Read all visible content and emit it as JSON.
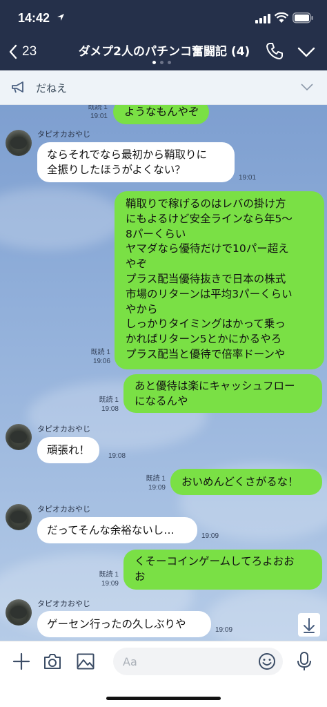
{
  "status_bar": {
    "time": "14:42"
  },
  "header": {
    "back_count": "23",
    "title": "ダメプ2人のパチンコ奮闘記 (4)"
  },
  "announcement": {
    "text": "だねえ"
  },
  "messages": [
    {
      "side": "me",
      "text": "ようなもんやぞ",
      "read": "既読 1",
      "time": "19:01"
    },
    {
      "side": "them",
      "sender": "タピオカおやじ",
      "lines": [
        "ならそれでなら最初から鞘取りに",
        "全振りしたほうがよくない？"
      ],
      "time": "19:01"
    },
    {
      "side": "me",
      "lines": [
        "鞘取りで稼げるのはレバの掛け方",
        "にもよるけど安全ラインなら年5〜",
        "8パーくらい",
        "ヤマダなら優待だけで10パー超え",
        "やぞ",
        "プラス配当優待抜きで日本の株式",
        "市場のリターンは平均3パーくらい",
        "やから",
        "しっかりタイミングはかって乗っ",
        "かればリターン5とかにかるやろ",
        "プラス配当と優待で倍率ドーンや"
      ],
      "read": "既読 1",
      "time": "19:06"
    },
    {
      "side": "me",
      "lines": [
        "あと優待は楽にキャッシュフロー",
        "になるんや"
      ],
      "read": "既読 1",
      "time": "19:08"
    },
    {
      "side": "them",
      "sender": "タピオカおやじ",
      "lines": [
        "頑張れ！"
      ],
      "time": "19:08"
    },
    {
      "side": "me",
      "lines": [
        "おいめんどくさがるな！"
      ],
      "read": "既読 1",
      "time": "19:09"
    },
    {
      "side": "them",
      "sender": "タピオカおやじ",
      "lines": [
        "だってそんな余裕ないし…"
      ],
      "time": "19:09"
    },
    {
      "side": "me",
      "lines": [
        "くそーコインゲームしてろよおお",
        "お"
      ],
      "read": "既読 1",
      "time": "19:09"
    },
    {
      "side": "them",
      "sender": "タピオカおやじ",
      "lines": [
        "ゲーセン行ったの久しぶりや"
      ],
      "time": "19:09"
    }
  ],
  "input": {
    "placeholder": "Aa"
  },
  "colors": {
    "header_bg": "#25304a",
    "my_bubble": "#7ae045",
    "their_bubble": "#ffffff"
  },
  "icons": [
    "location-arrow-icon",
    "signal-icon",
    "wifi-icon",
    "battery-icon",
    "back-chevron-icon",
    "phone-icon",
    "chevron-down-icon",
    "megaphone-icon",
    "arrow-down-icon",
    "plus-icon",
    "camera-icon",
    "image-icon",
    "emoji-icon",
    "mic-icon"
  ]
}
